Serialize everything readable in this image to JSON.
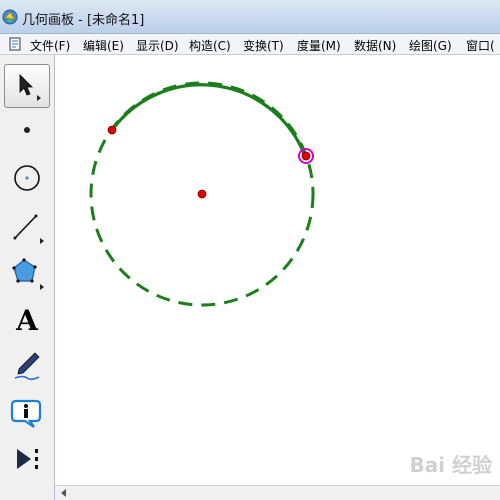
{
  "window": {
    "title": "几何画板 - [未命名1]"
  },
  "menu": {
    "items": [
      {
        "label": "文件(F)"
      },
      {
        "label": "编辑(E)"
      },
      {
        "label": "显示(D)"
      },
      {
        "label": "构造(C)"
      },
      {
        "label": "变换(T)"
      },
      {
        "label": "度量(M)"
      },
      {
        "label": "数据(N)"
      },
      {
        "label": "绘图(G)"
      },
      {
        "label": "窗口("
      }
    ]
  },
  "toolbox": {
    "tools": [
      {
        "name": "arrow-select-tool",
        "icon": "arrow-pointer-icon",
        "selected": true
      },
      {
        "name": "point-tool",
        "icon": "point-icon",
        "selected": false
      },
      {
        "name": "compass-tool",
        "icon": "circle-compass-icon",
        "selected": false
      },
      {
        "name": "straightedge-tool",
        "icon": "line-segment-icon",
        "selected": false
      },
      {
        "name": "polygon-tool",
        "icon": "pentagon-icon",
        "selected": false
      },
      {
        "name": "text-tool",
        "icon": "text-a-icon",
        "label": "A",
        "selected": false
      },
      {
        "name": "marker-tool",
        "icon": "pen-marker-icon",
        "selected": false
      },
      {
        "name": "information-tool",
        "icon": "info-bubble-icon",
        "selected": false
      },
      {
        "name": "custom-tool",
        "icon": "play-custom-icon",
        "selected": false
      }
    ]
  },
  "canvas": {
    "arc_color": "#1a7f1a",
    "point_color": "#e00000",
    "selected_point_highlight": "#d400d4"
  },
  "watermark": {
    "text": "Bai 经验"
  }
}
